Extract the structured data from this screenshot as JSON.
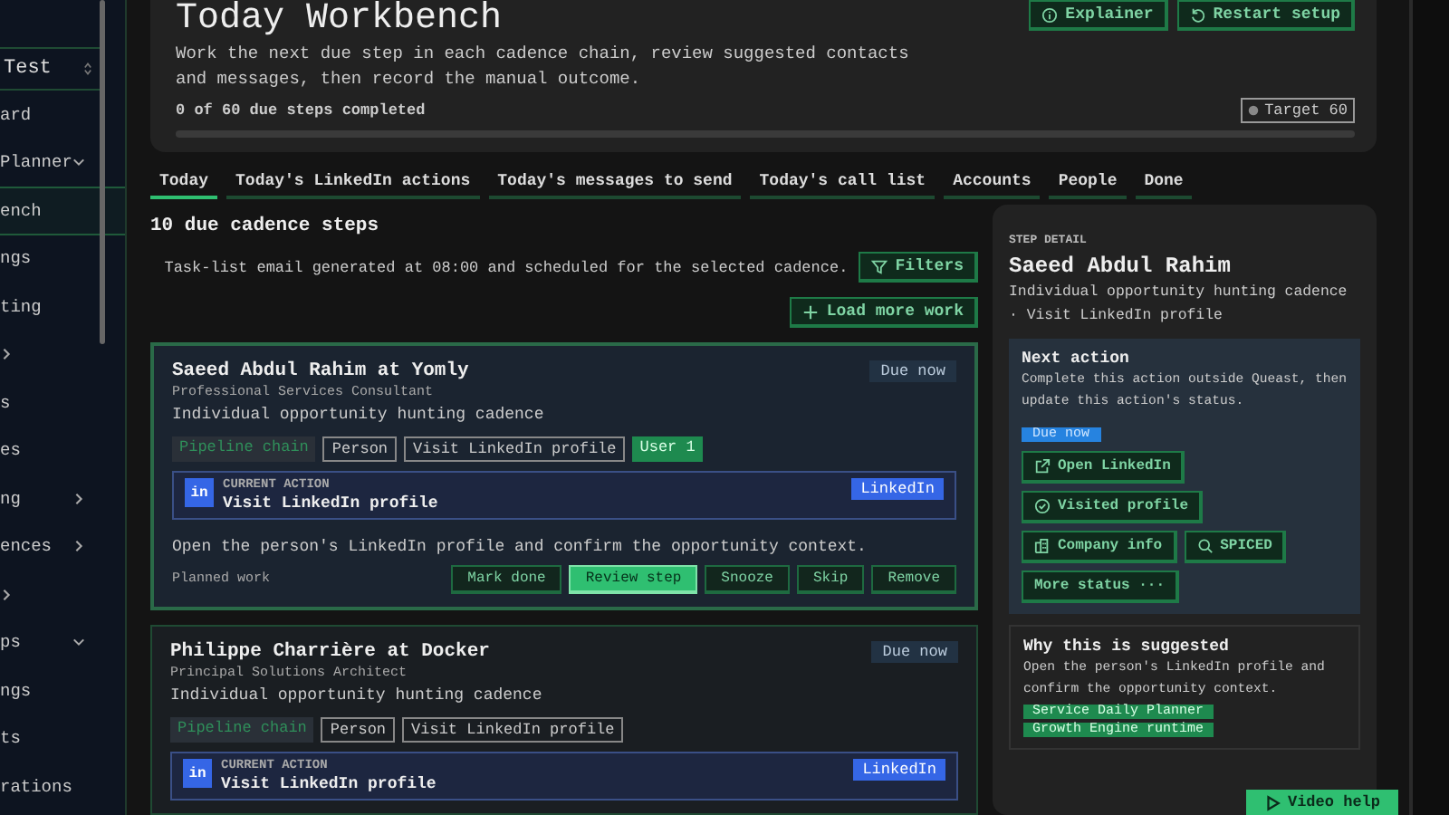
{
  "sidebar": {
    "workspace": "Test",
    "items": [
      {
        "label": "ard",
        "selected": false
      },
      {
        "label": "Planner",
        "selected": false,
        "expanded": true
      },
      {
        "label": "ench",
        "selected": true
      },
      {
        "label": "ngs",
        "selected": false
      },
      {
        "label": "ting",
        "selected": false
      },
      {
        "selected": false,
        "expanded": false
      },
      {
        "label": "s",
        "selected": false
      },
      {
        "label": "es",
        "selected": false
      },
      {
        "label": "ng",
        "selected": false,
        "expanded": false
      },
      {
        "label": "ences",
        "selected": false,
        "expanded": false
      },
      {
        "selected": false,
        "expanded": false
      },
      {
        "label": "ps",
        "selected": false,
        "expanded": true
      },
      {
        "label": "ngs",
        "selected": false
      },
      {
        "label": "ts",
        "selected": false
      },
      {
        "label": "rations",
        "selected": false
      }
    ]
  },
  "header": {
    "title": "Today Workbench",
    "description": "Work the next due step in each cadence chain, review suggested contacts and messages, then record the manual outcome.",
    "buttons": [
      "Explainer",
      "Restart setup"
    ],
    "progress": {
      "label": "0 of 60 due steps completed",
      "target": "Target 60",
      "level": 0
    }
  },
  "tabs": [
    {
      "label": "Today",
      "selected": true
    },
    {
      "label": "Today's LinkedIn actions",
      "selected": false
    },
    {
      "label": "Today's messages to send",
      "selected": false
    },
    {
      "label": "Today's call list",
      "selected": false
    },
    {
      "label": "Accounts",
      "selected": false
    },
    {
      "label": "People",
      "selected": false
    },
    {
      "label": "Done",
      "selected": false
    }
  ],
  "list": {
    "heading": "10 due cadence steps",
    "note": "Task-list email generated at 08:00 and scheduled for the selected cadence.",
    "filter_button": "Filters",
    "load_more_button": "Load more work",
    "cards": [
      {
        "selected": true,
        "name": "Saeed Abdul Rahim at Yomly",
        "role": "Professional Services Consultant",
        "cadence": "Individual opportunity hunting cadence",
        "status": "Due now",
        "tags": [
          {
            "label": "Pipeline chain",
            "kind": "muted"
          },
          {
            "label": "Person",
            "kind": "outline"
          },
          {
            "label": "Visit LinkedIn profile",
            "kind": "outline"
          },
          {
            "label": "User 1",
            "kind": "green"
          }
        ],
        "action": {
          "caption": "CURRENT ACTION",
          "title": "Visit LinkedIn profile",
          "channel": "LinkedIn",
          "badge": "in"
        },
        "description": "Open the person's LinkedIn profile and confirm the opportunity context.",
        "footer": "Planned work",
        "buttons": [
          {
            "label": "Mark done",
            "selected": false
          },
          {
            "label": "Review step",
            "selected": true
          },
          {
            "label": "Snooze",
            "selected": false
          },
          {
            "label": "Skip",
            "selected": false
          },
          {
            "label": "Remove",
            "selected": false
          }
        ]
      },
      {
        "selected": false,
        "name": "Philippe Charrière at Docker",
        "role": "Principal Solutions Architect",
        "cadence": "Individual opportunity hunting cadence",
        "status": "Due now",
        "tags": [
          {
            "label": "Pipeline chain",
            "kind": "muted"
          },
          {
            "label": "Person",
            "kind": "outline"
          },
          {
            "label": "Visit LinkedIn profile",
            "kind": "outline"
          }
        ],
        "action": {
          "caption": "CURRENT ACTION",
          "title": "Visit LinkedIn profile",
          "channel": "LinkedIn",
          "badge": "in"
        }
      }
    ]
  },
  "detail": {
    "caption": "STEP DETAIL",
    "name": "Saeed Abdul Rahim",
    "subtitle": "Individual opportunity hunting cadence · Visit LinkedIn profile",
    "next_action": {
      "title": "Next action",
      "text": "Complete this action outside Queast, then update this action's status.",
      "badge": "Due now",
      "buttons": [
        "Open LinkedIn",
        "Visited profile",
        "Company info",
        "SPICED",
        "More status ···"
      ]
    },
    "why": {
      "title": "Why this is suggested",
      "text": "Open the person's LinkedIn profile and confirm the opportunity context.",
      "tags": [
        "Service Daily Planner",
        "Growth Engine runtime"
      ]
    }
  },
  "video_help": "Video help"
}
